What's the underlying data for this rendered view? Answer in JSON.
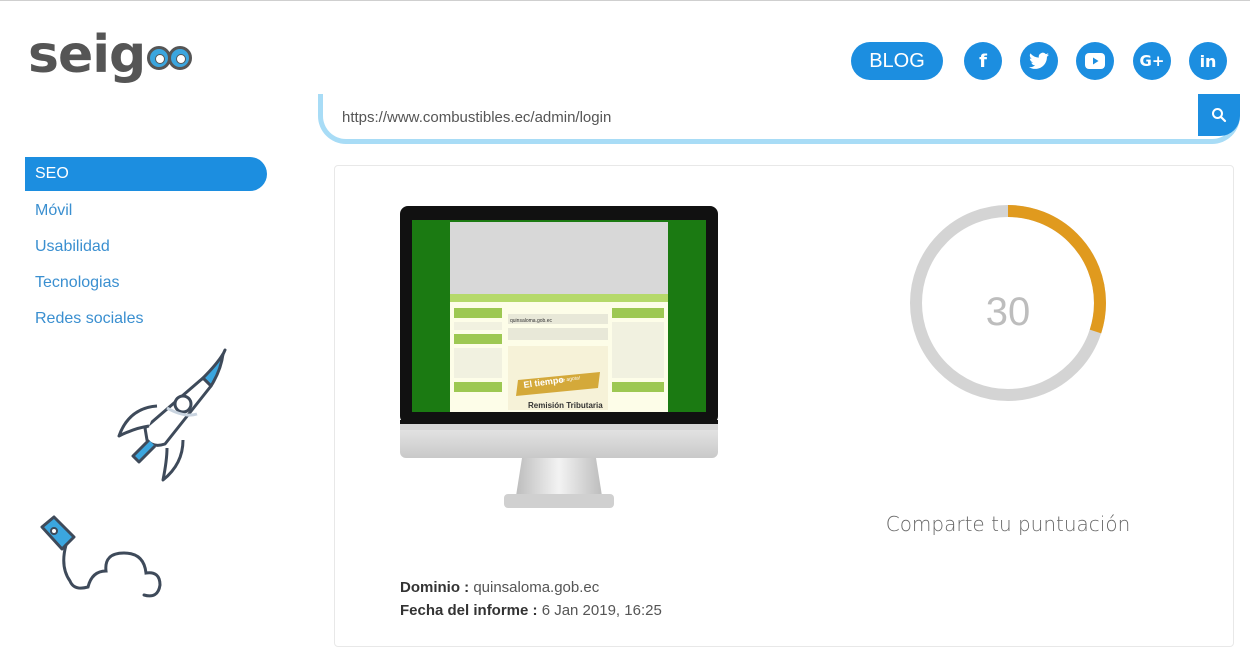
{
  "header": {
    "logo_text": "seig",
    "blog_label": "BLOG",
    "social": [
      {
        "name": "facebook-icon",
        "glyph": "f"
      },
      {
        "name": "twitter-icon",
        "glyph": "t"
      },
      {
        "name": "youtube-icon",
        "glyph": "▶"
      },
      {
        "name": "google-plus-icon",
        "glyph": "G+"
      },
      {
        "name": "linkedin-icon",
        "glyph": "in"
      }
    ]
  },
  "search": {
    "value": "https://www.combustibles.ec/admin/login",
    "icon": "search-icon"
  },
  "sidebar": {
    "items": [
      {
        "label": "SEO",
        "active": true
      },
      {
        "label": "Móvil",
        "active": false
      },
      {
        "label": "Usabilidad",
        "active": false
      },
      {
        "label": "Tecnologias",
        "active": false
      },
      {
        "label": "Redes sociales",
        "active": false
      }
    ]
  },
  "report": {
    "score": "30",
    "score_fraction": 0.3,
    "share_label": "Comparte tu puntuación",
    "domain_label": "Dominio :",
    "domain_value": " quinsaloma.gob.ec",
    "date_label": "Fecha del informe :",
    "date_value": " 6 Jan 2019, 16:25"
  },
  "screenshot": {
    "site_title": "quinsaloma.gob.ec",
    "banner_line1": "El tiempo",
    "banner_line2": "se agota!",
    "banner_caption": "Remisión Tributaria"
  },
  "colors": {
    "accent": "#1c8ee0",
    "donut_track": "#d4d4d4",
    "donut_fill": "#e09a1e",
    "site_green": "#1b7a12"
  }
}
